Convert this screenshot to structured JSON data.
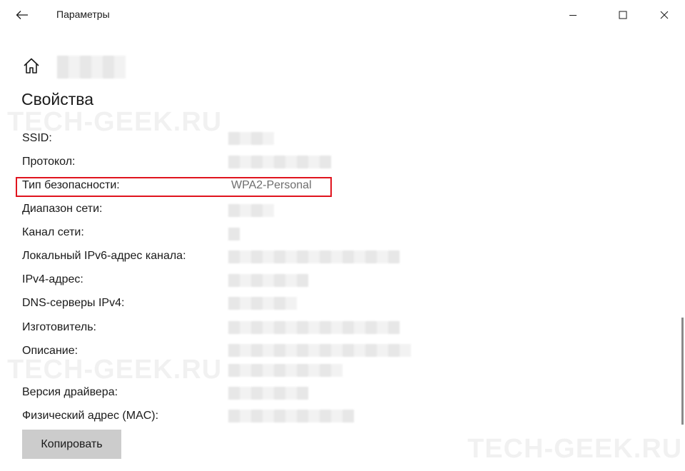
{
  "window": {
    "title": "Параметры",
    "back_icon": "back-arrow-icon",
    "controls": [
      "minimize-icon",
      "maximize-icon",
      "close-icon"
    ]
  },
  "header": {
    "home_icon": "home-icon"
  },
  "section": {
    "title": "Свойства"
  },
  "watermark": "TECH-GEEK.RU",
  "properties": [
    {
      "label": "SSID:"
    },
    {
      "label": "Протокол:"
    },
    {
      "label": "Тип безопасности:",
      "value": "WPA2-Personal",
      "highlighted": true
    },
    {
      "label": "Диапазон сети:"
    },
    {
      "label": "Канал сети:"
    },
    {
      "label": "Локальный IPv6-адрес канала:"
    },
    {
      "label": "IPv4-адрес:"
    },
    {
      "label": "DNS-серверы IPv4:"
    },
    {
      "label": "Изготовитель:"
    },
    {
      "label": "Описание:"
    },
    {
      "label": "Версия драйвера:"
    },
    {
      "label": "Физический адрес (MAC):"
    }
  ],
  "actions": {
    "copy_label": "Копировать"
  },
  "colors": {
    "highlight_border": "#e0141e",
    "button_bg": "#cccccc",
    "value_text": "#6e6e6e"
  }
}
